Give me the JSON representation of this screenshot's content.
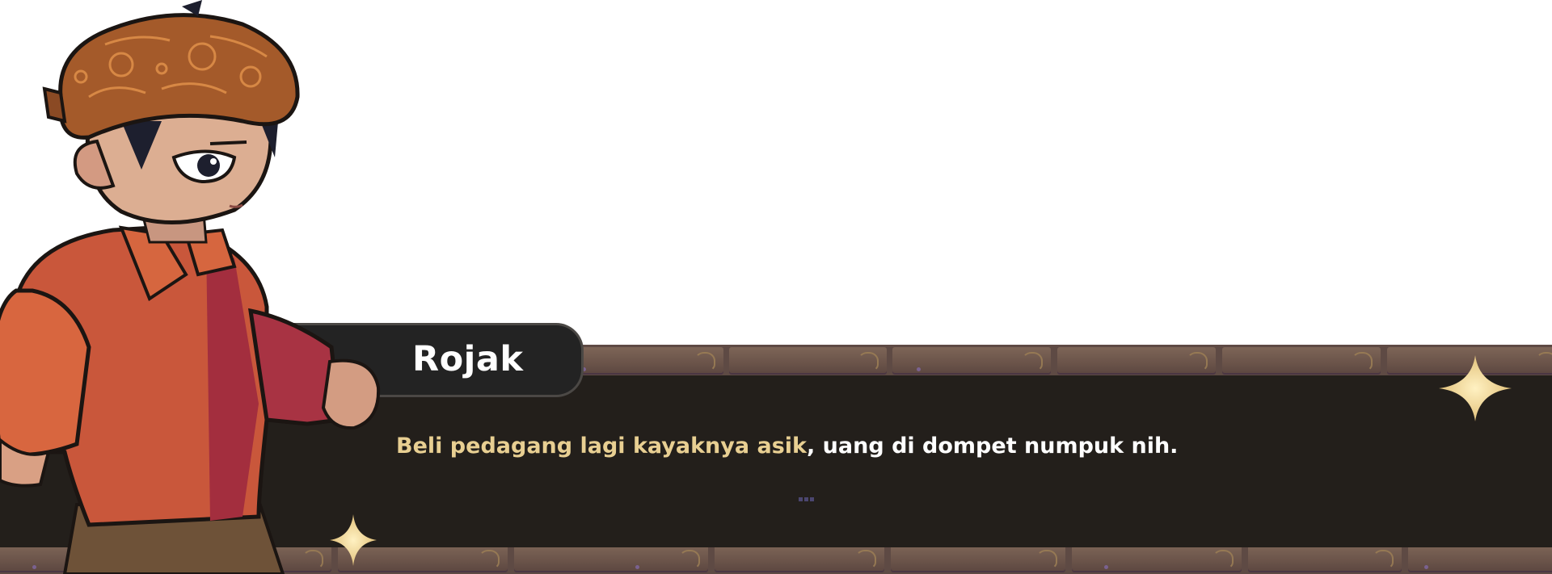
{
  "dialog": {
    "speaker_name": "Rojak",
    "line_highlight": "Beli pedagang lagi kayaknya asik",
    "line_rest": ", uang di dompet numpuk nih.",
    "continue_indicator": "..."
  },
  "colors": {
    "panel": "#231f1b",
    "name_plate": "#232323",
    "highlight_text": "#e8cf92",
    "body_text": "#ffffff",
    "brick": "#6a5349"
  },
  "icons": {
    "sparkle_right": "sparkle-star-icon",
    "sparkle_left": "sparkle-star-icon"
  }
}
